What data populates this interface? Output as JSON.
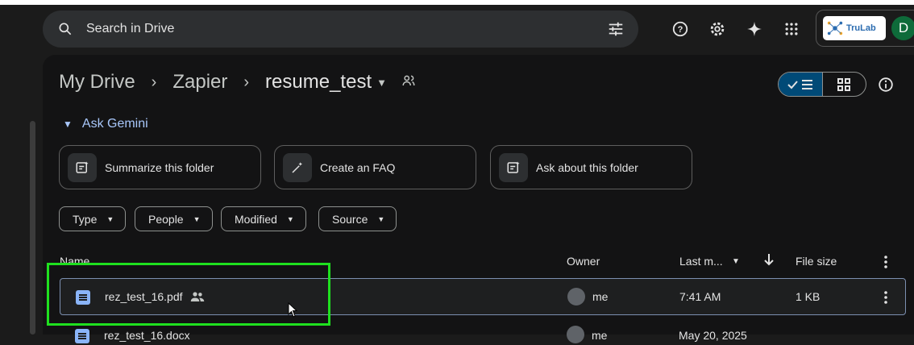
{
  "search": {
    "placeholder": "Search in Drive"
  },
  "account": {
    "logo_text": "TruLab",
    "avatar_letter": "D"
  },
  "breadcrumb": {
    "items": [
      "My Drive",
      "Zapier",
      "resume_test"
    ]
  },
  "gemini": {
    "label": "Ask Gemini"
  },
  "suggestions": [
    "Summarize this folder",
    "Create an FAQ",
    "Ask about this folder"
  ],
  "filters": [
    "Type",
    "People",
    "Modified",
    "Source"
  ],
  "columns": {
    "name": "Name",
    "owner": "Owner",
    "modified": "Last m...",
    "size": "File size"
  },
  "files": [
    {
      "name": "rez_test_16.pdf",
      "owner": "me",
      "modified": "7:41 AM",
      "size": "1 KB"
    },
    {
      "name": "rez_test_16.docx",
      "owner": "me",
      "modified": "May 20, 2025",
      "size": ""
    }
  ],
  "colors": {
    "accent": "#a8c7fa",
    "highlight": "#1fe01f",
    "panel": "#131314"
  }
}
